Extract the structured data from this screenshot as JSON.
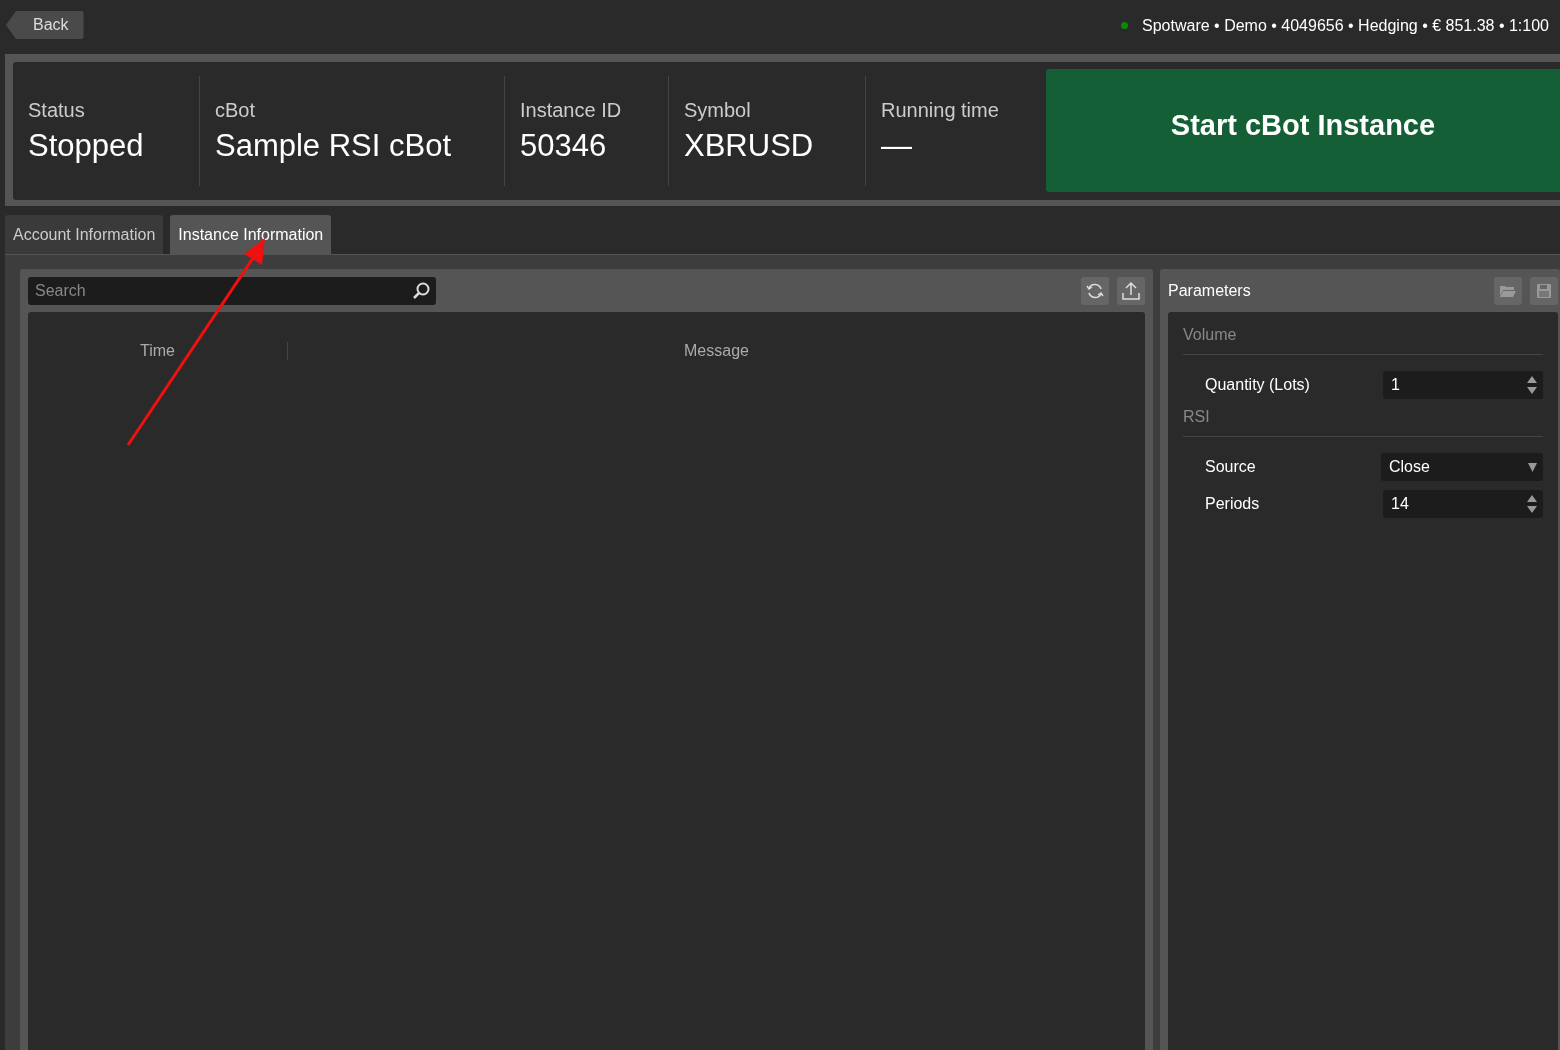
{
  "top_bar": {
    "back": "Back",
    "account": "Spotware • Demo • 4049656 • Hedging • € 851.38 • 1:100"
  },
  "summary": [
    {
      "label": "Status",
      "value": "Stopped"
    },
    {
      "label": "cBot",
      "value": "Sample RSI cBot"
    },
    {
      "label": "Instance ID",
      "value": "50346"
    },
    {
      "label": "Symbol",
      "value": "XBRUSD"
    },
    {
      "label": "Running time",
      "value": "—"
    }
  ],
  "start_button": "Start cBot Instance",
  "tabs": [
    {
      "label": "Account Information",
      "selected": false
    },
    {
      "label": "Instance Information",
      "selected": true
    }
  ],
  "log": {
    "search": {
      "placeholder": "Search"
    },
    "columns": [
      "Time",
      "Message"
    ]
  },
  "parameters": {
    "title": "Parameters",
    "groups": [
      {
        "name": "Volume",
        "items": [
          {
            "kind": "number",
            "label": "Quantity (Lots)",
            "value": "1"
          }
        ]
      },
      {
        "name": "RSI",
        "items": [
          {
            "kind": "select",
            "label": "Source",
            "value": "Close"
          },
          {
            "kind": "number",
            "label": "Periods",
            "value": "14"
          }
        ]
      }
    ]
  }
}
